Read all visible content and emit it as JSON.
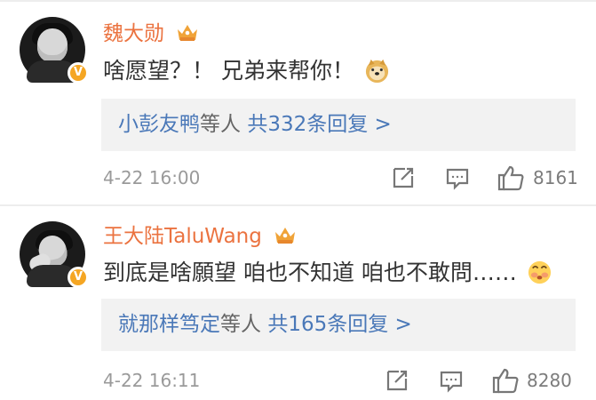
{
  "comments": [
    {
      "author": "魏大勋",
      "text": "啥愿望？！ 兄弟来帮你！",
      "reply_preview": {
        "names": "小彭友鸭",
        "suffix": "等人",
        "count_text": "共332条回复 >"
      },
      "timestamp": "4-22 16:00",
      "likes": "8161",
      "icons": [
        "crown-badge-icon",
        "verified-badge-icon",
        "doge-emoji",
        "share-icon",
        "comment-icon",
        "like-icon"
      ]
    },
    {
      "author": "王大陆TaluWang",
      "text": "到底是啥願望 咱也不知道 咱也不敢問……",
      "reply_preview": {
        "names": "就那样笃定",
        "suffix": "等人",
        "count_text": "共165条回复 >"
      },
      "timestamp": "4-22 16:11",
      "likes": "8280",
      "icons": [
        "crown-badge-icon",
        "verified-badge-icon",
        "shy-emoji",
        "share-icon",
        "comment-icon",
        "like-icon"
      ]
    }
  ],
  "colors": {
    "name": "#eb7340",
    "reply_names": "#4a78b8",
    "reply_background": "#f2f2f2",
    "meta": "#9a9a9a",
    "verified": "#f5a623"
  }
}
